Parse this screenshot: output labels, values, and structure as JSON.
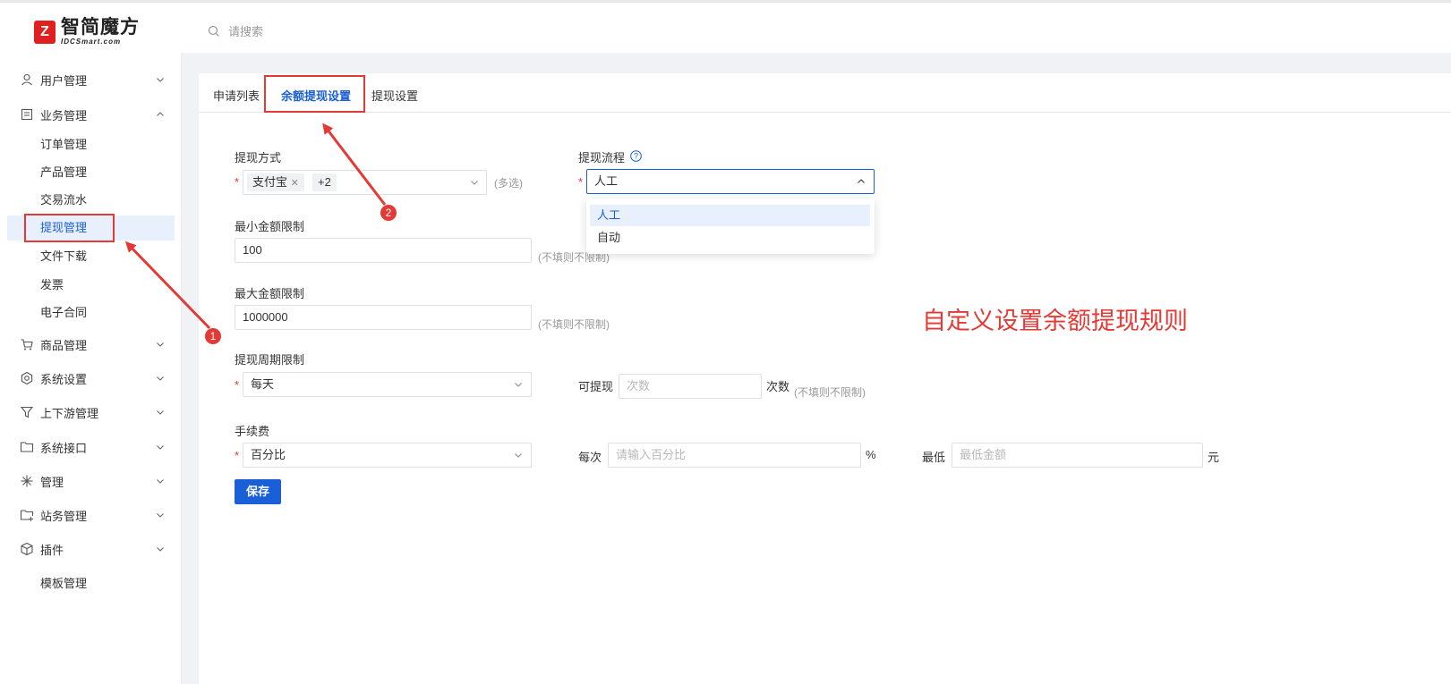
{
  "header": {
    "logo_cn": "智简魔方",
    "logo_en": "IDCSmart.com",
    "search_placeholder": "请搜索"
  },
  "sidebar": {
    "groups": [
      {
        "label": "用户管理",
        "icon": "user-icon",
        "expanded": false
      },
      {
        "label": "业务管理",
        "icon": "document-icon",
        "expanded": true
      },
      {
        "label": "商品管理",
        "icon": "cart-icon",
        "expanded": false
      },
      {
        "label": "系统设置",
        "icon": "gear-icon",
        "expanded": false
      },
      {
        "label": "上下游管理",
        "icon": "filter-icon",
        "expanded": false
      },
      {
        "label": "系统接口",
        "icon": "folder-icon",
        "expanded": false
      },
      {
        "label": "管理",
        "icon": "sparkle-icon",
        "expanded": false
      },
      {
        "label": "站务管理",
        "icon": "folder-plus-icon",
        "expanded": false
      },
      {
        "label": "插件",
        "icon": "box-icon",
        "expanded": false
      }
    ],
    "business_items": [
      "订单管理",
      "产品管理",
      "交易流水",
      "提现管理",
      "文件下载",
      "发票",
      "电子合同"
    ],
    "active_item": "提现管理",
    "plugin_items": [
      "模板管理"
    ]
  },
  "tabs": [
    "申请列表",
    "余额提现设置",
    "提现设置"
  ],
  "active_tab": "余额提现设置",
  "form": {
    "method_label": "提现方式",
    "method_tag": "支付宝",
    "method_more": "+2",
    "method_hint": "(多选)",
    "flow_label": "提现流程",
    "flow_value": "人工",
    "flow_options": [
      "人工",
      "自动"
    ],
    "min_label": "最小金额限制",
    "min_value": "100",
    "min_hint": "(不填则不限制)",
    "max_label": "最大金额限制",
    "max_value": "1000000",
    "max_hint": "(不填则不限制)",
    "period_label": "提现周期限制",
    "period_value": "每天",
    "times_prefix": "可提现",
    "times_placeholder": "次数",
    "times_suffix": "次数",
    "times_hint": "(不填则不限制)",
    "fee_label": "手续费",
    "fee_type": "百分比",
    "each_label": "每次",
    "each_placeholder": "请输入百分比",
    "percent_unit": "%",
    "min_fee_label": "最低",
    "min_fee_placeholder": "最低金额",
    "currency_unit": "元",
    "save_label": "保存"
  },
  "annotation": {
    "text": "自定义设置余额提现规则",
    "badge1": "1",
    "badge2": "2",
    "color": "#e53935"
  },
  "colors": {
    "primary": "#1a5fd8",
    "annotation_red": "#e53935"
  }
}
